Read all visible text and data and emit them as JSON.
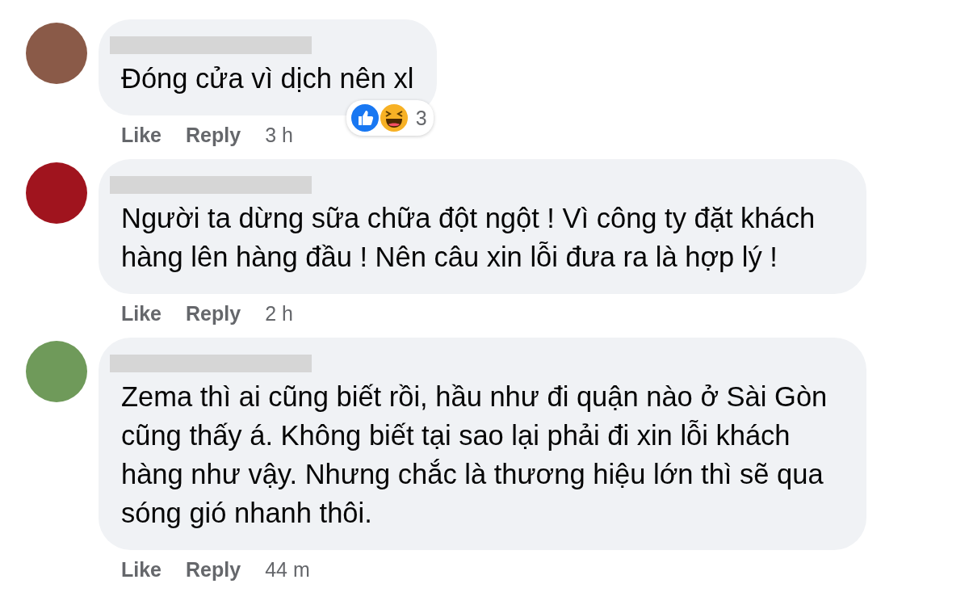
{
  "comments": [
    {
      "text_lines": [
        "Đóng cửa vì dịch nên xl"
      ],
      "reactions": {
        "icons": [
          {
            "kind": "like"
          },
          {
            "kind": "haha"
          }
        ],
        "count": "3"
      },
      "actions": [
        "Like",
        "Reply"
      ],
      "time": "3 h"
    },
    {
      "text_lines": [
        "Người ta dừng sữa chữa đột ngột ! Vì công ty đặt khách",
        "hàng lên hàng đầu ! Nên câu xin lỗi đưa ra là hợp lý !"
      ],
      "actions": [
        "Like",
        "Reply"
      ],
      "time": "2 h"
    },
    {
      "text_lines": [
        "Zema thì ai cũng biết rồi, hầu như đi quận nào ở Sài Gòn",
        "cũng thấy á. Không biết tại sao lại phải đi xin lỗi khách",
        "hàng như vậy. Nhưng chắc là thương hiệu lớn thì sẽ qua",
        "sóng gió nhanh thôi."
      ],
      "actions": [
        "Like",
        "Reply"
      ],
      "time": "44 m"
    }
  ]
}
